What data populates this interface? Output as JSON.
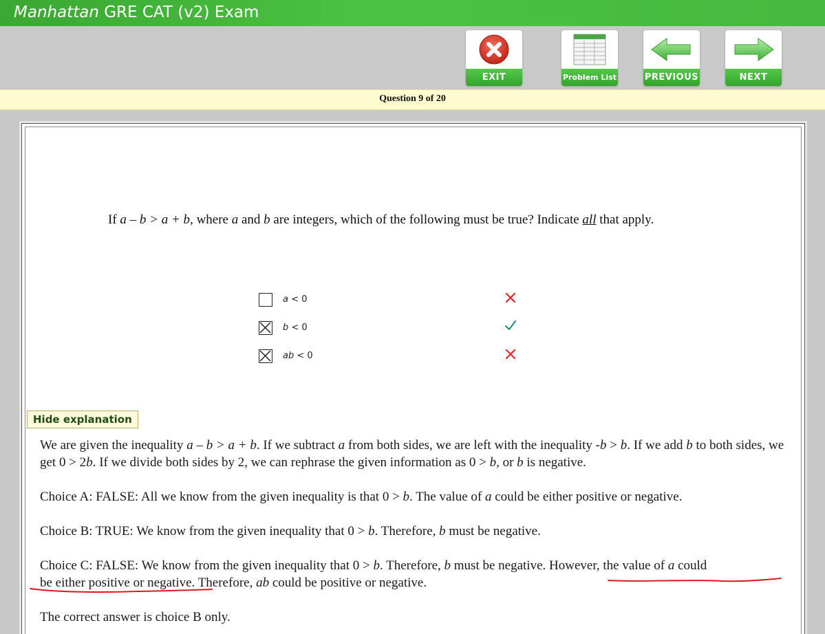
{
  "window": {
    "title_brand": "Manhattan",
    "title_rest": " GRE CAT (v2) Exam"
  },
  "toolbar": {
    "exit_label": "EXIT",
    "problem_list_label": "Problem List",
    "previous_label": "PREVIOUS",
    "next_label": "NEXT"
  },
  "progress": {
    "text": "Question 9 of 20",
    "current": 9,
    "total": 20
  },
  "question": {
    "p1": "If ",
    "expr": "a – b > a + b",
    "p2": ", where ",
    "a": "a",
    "p3": " and ",
    "b": "b",
    "p4": " are integers, which of the following must be true?  Indicate ",
    "all": "all",
    "p5": " that apply."
  },
  "choices": [
    {
      "label_var": "a",
      "label_rest": " < 0",
      "checked": false,
      "result": "incorrect"
    },
    {
      "label_var": "b",
      "label_rest": " < 0",
      "checked": true,
      "result": "correct"
    },
    {
      "label_var": "ab",
      "label_rest": " < 0",
      "checked": true,
      "result": "incorrect"
    }
  ],
  "hide_explanation_label": "Hide explanation",
  "explanation": {
    "para1": {
      "t1": "We are given the inequality ",
      "e1": "a – b > a + b",
      "t2": ". If we subtract ",
      "e2": "a",
      "t3": " from both sides, we are left with the inequality -",
      "e3": "b",
      "t4": " > ",
      "e4": "b",
      "t5": ". If we add ",
      "e5": "b",
      "t6": " to both sides, we get 0 > 2",
      "e6": "b",
      "t7": ". If we divide both sides by 2, we can rephrase the given information as 0 > ",
      "e7": "b",
      "t8": ", or ",
      "e8": "b",
      "t9": " is negative."
    },
    "choiceA": {
      "t1": "Choice A: FALSE: All we know from the given inequality is that 0 > ",
      "e1": "b",
      "t2": ". The value of ",
      "e2": "a",
      "t3": " could be either positive or negative."
    },
    "choiceB": {
      "t1": "Choice B: TRUE: We know from the given inequality that 0 > ",
      "e1": "b",
      "t2": ". Therefore, ",
      "e2": "b",
      "t3": " must be negative."
    },
    "choiceC": {
      "t1": "Choice C: FALSE: We know from the given inequality that 0 > ",
      "e1": "b",
      "t2": ". Therefore, ",
      "e2": "b",
      "t3": " must be negative. However, the value of ",
      "e3": "a",
      "t4": " could",
      "t5": "be either positive or negative. Therefore, ",
      "e4": "ab",
      "t6": " could be positive or negative."
    },
    "answer": "The correct answer is choice B only."
  },
  "colors": {
    "title_green": "#46b83e",
    "button_green": "#34a42c",
    "question_bar": "#fffbd1",
    "wrong_mark": "#e8242a",
    "right_mark": "#1f8a80",
    "annotation_red": "#e01818"
  }
}
